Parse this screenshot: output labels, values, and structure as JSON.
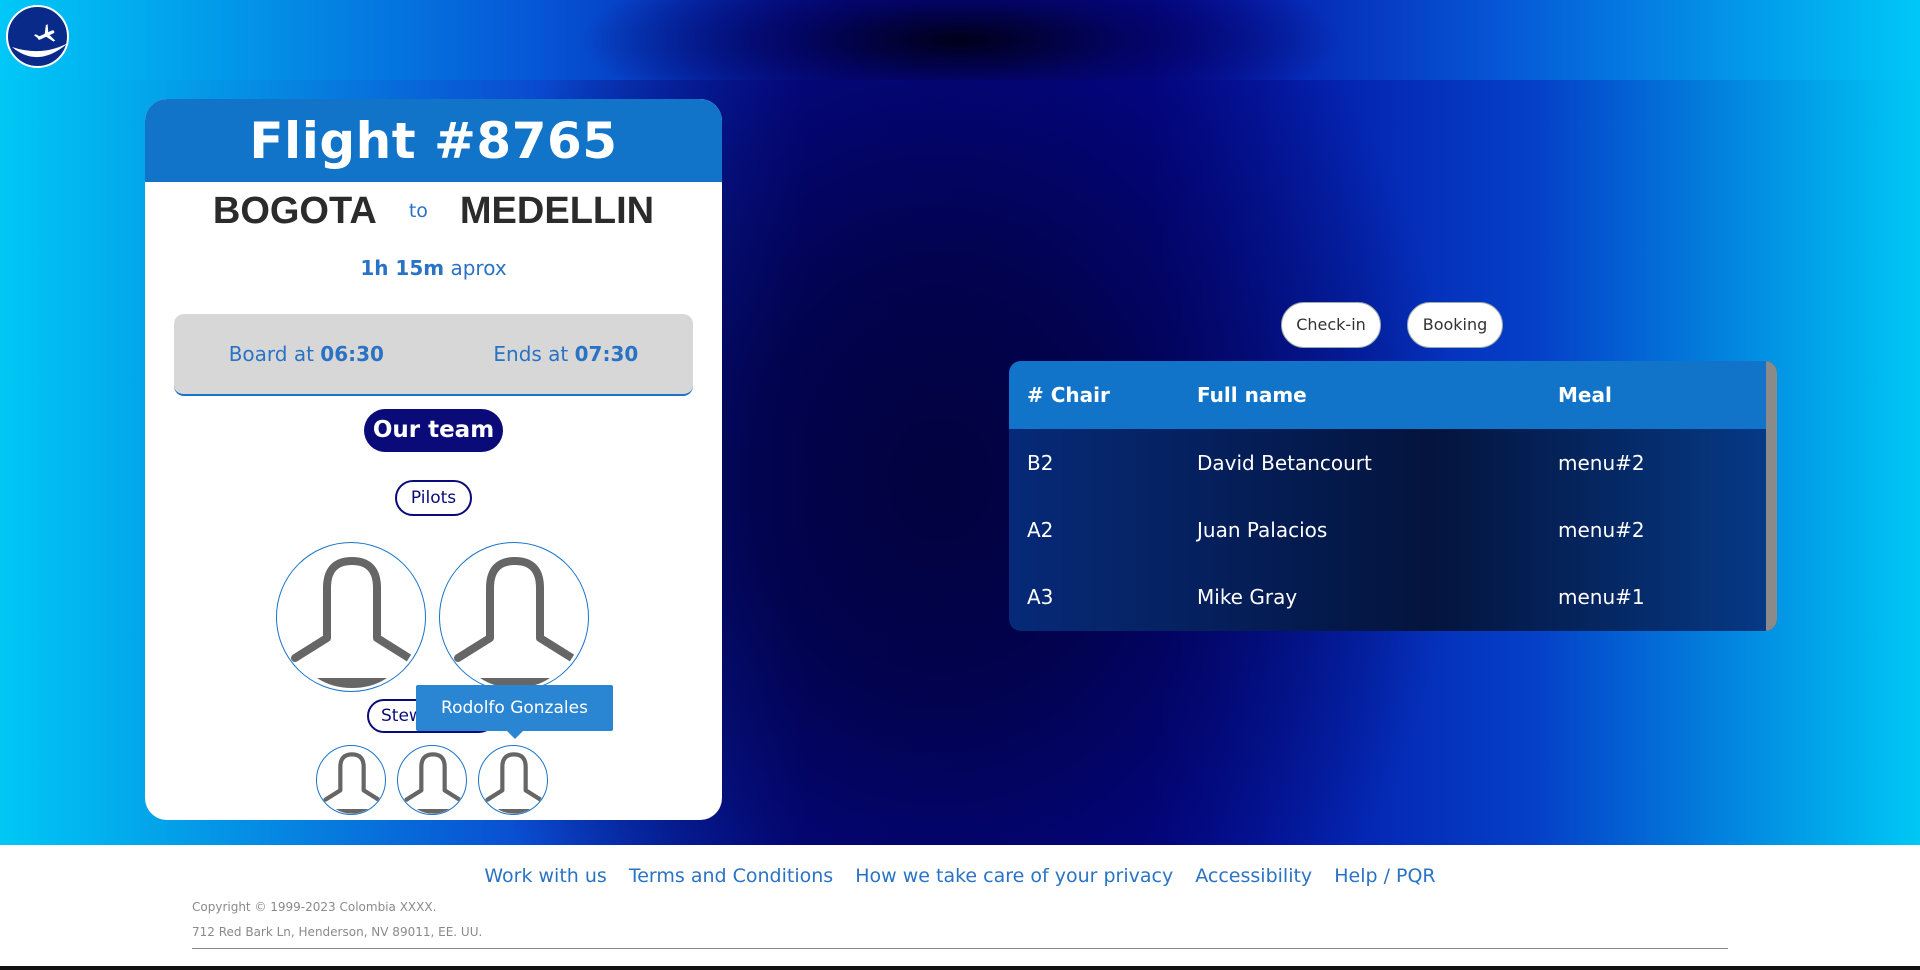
{
  "flight": {
    "title": "Flight #8765",
    "origin": "BOGOTA",
    "to_word": "to",
    "destination": "MEDELLIN",
    "duration_value": "1h 15m",
    "duration_suffix": "aprox",
    "board_label": "Board at",
    "board_time": "06:30",
    "ends_label": "Ends at",
    "ends_time": "07:30"
  },
  "team": {
    "title": "Our team",
    "pilots_label": "Pilots",
    "stewards_label": "Stewardesses",
    "tooltip": "Rodolfo Gonzales"
  },
  "tabs": [
    {
      "label": "Check-in"
    },
    {
      "label": "Booking"
    }
  ],
  "table": {
    "headers": [
      "# Chair",
      "Full name",
      "Meal"
    ],
    "rows": [
      [
        "B2",
        "David Betancourt",
        "menu#2"
      ],
      [
        "A2",
        "Juan Palacios",
        "menu#2"
      ],
      [
        "A3",
        "Mike Gray",
        "menu#1"
      ]
    ]
  },
  "footer": {
    "links": [
      "Work with us",
      "Terms and Conditions",
      "How we take care of your privacy",
      "Accessibility",
      "Help / PQR"
    ],
    "copyright": "Copyright © 1999-2023 Colombia XXXX.",
    "address": "712 Red Bark Ln, Henderson, NV 89011, EE. UU."
  },
  "colors": {
    "primary": "#1174c9",
    "navy": "#0a0a78",
    "link": "#2a73c4"
  },
  "icons": {
    "logo": "airplane-logo-icon",
    "avatar": "person-silhouette-icon"
  }
}
